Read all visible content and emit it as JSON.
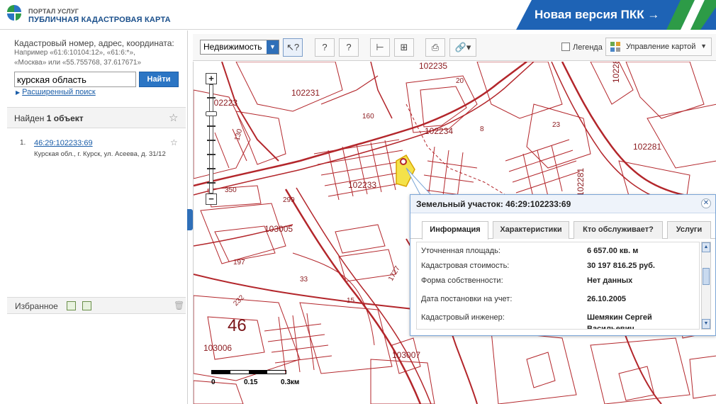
{
  "header": {
    "portal_small": "ПОРТАЛ УСЛУГ",
    "portal_big": "ПУБЛИЧНАЯ КАДАСТРОВАЯ КАРТА",
    "new_version": "Новая версия ПКК →"
  },
  "search": {
    "hint_title": "Кадастровый номер, адрес, координата:",
    "hint_example1": "Например «61:6:10104:12», «61:6:*»,",
    "hint_example2": "«Москва» или «55.755768, 37.617671»",
    "value": "курская область",
    "button": "Найти",
    "advanced": "Расширенный поиск"
  },
  "results": {
    "found_prefix": "Найден",
    "found_count": "1",
    "found_suffix": "объект",
    "items": [
      {
        "num": "1.",
        "cadastral": "46:29:102233:69",
        "address": "Курская обл., г. Курск, ул. Асеева, д. 31/12"
      }
    ]
  },
  "favorites": {
    "label": "Избранное"
  },
  "toolbar": {
    "layer_select": "Недвижимость",
    "legend": "Легенда",
    "map_control": "Управление картой"
  },
  "map": {
    "labels": {
      "q102231": "102231",
      "q102223": "102223",
      "q102234": "102234",
      "q102233": "102233",
      "q102235": "102235",
      "q102281": "102281",
      "q102281b": "102281",
      "q103005": "103005",
      "q103006": "103006",
      "q103007": "103007",
      "q102283": "102283",
      "district": "46",
      "n160": "160",
      "n130": "130",
      "n299": "299",
      "n197": "197",
      "n33": "33",
      "n23": "23",
      "n8": "8",
      "n20": "20",
      "n15": "15",
      "n1727": "1727",
      "n232": "232",
      "n350": "350"
    },
    "scale": {
      "t0": "0",
      "t1": "0.15",
      "t2": "0.3км"
    }
  },
  "popup": {
    "title": "Земельный участок: 46:29:102233:69",
    "tabs": [
      "Информация",
      "Характеристики",
      "Кто обслуживает?",
      "Услуги"
    ],
    "rows": [
      {
        "k": "Уточненная площадь:",
        "v": "6 657.00 кв. м"
      },
      {
        "k": "Кадастровая стоимость:",
        "v": "30 197 816.25 руб."
      },
      {
        "k": "Форма собственности:",
        "v": "Нет данных"
      },
      {
        "k": "Дата постановки на учет:",
        "v": "26.10.2005"
      },
      {
        "k": "Кадастровый инженер:",
        "v": "Шемякин Сергей Васильевич"
      }
    ]
  },
  "colors": {
    "parcel_line": "#b3262b",
    "highlight": "#f4e24a",
    "brand_blue": "#1e63b5"
  }
}
